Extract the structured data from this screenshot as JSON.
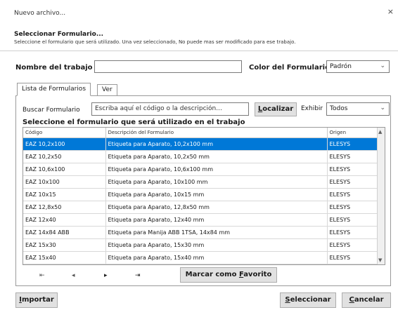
{
  "window": {
    "title": "Nuevo archivo...",
    "close": "×"
  },
  "header": {
    "section_title": "Seleccionar Formulario...",
    "description": "Seleccione el formulario que será utilizado. Una vez seleccionado, No puede mas ser modificado para ese trabajo."
  },
  "job": {
    "label": "Nombre del trabajo",
    "value": ""
  },
  "form_color": {
    "label": "Color del Formulario",
    "selected": "Padrón"
  },
  "tabs": [
    {
      "label": "Lista de Formularios",
      "active": true
    },
    {
      "label": "Ver",
      "active": false
    }
  ],
  "search": {
    "label": "Buscar Formulario",
    "placeholder": "Escriba aquí el código o la descripción...",
    "button_first": "L",
    "button_rest": "ocalizar"
  },
  "show": {
    "label": "Exhibir",
    "selected": "Todos"
  },
  "grid": {
    "title": "Seleccione el formulario que será utilizado en el trabajo",
    "columns": [
      "Código",
      "Descripción del Formulario",
      "Origen"
    ],
    "rows": [
      [
        "EAZ 10,2x100",
        "Etiqueta para Aparato, 10,2x100 mm",
        "ELESYS"
      ],
      [
        "EAZ 10,2x50",
        "Etiqueta para Aparato, 10,2x50 mm",
        "ELESYS"
      ],
      [
        "EAZ 10,6x100",
        "Etiqueta para Aparato, 10,6x100 mm",
        "ELESYS"
      ],
      [
        "EAZ 10x100",
        "Etiqueta para Aparato, 10x100 mm",
        "ELESYS"
      ],
      [
        "EAZ 10x15",
        "Etiqueta para Aparato, 10x15 mm",
        "ELESYS"
      ],
      [
        "EAZ 12,8x50",
        "Etiqueta para Aparato, 12,8x50 mm",
        "ELESYS"
      ],
      [
        "EAZ 12x40",
        "Etiqueta para Aparato, 12x40 mm",
        "ELESYS"
      ],
      [
        "EAZ 14x84 ABB",
        "Etiqueta para Manija ABB 1TSA, 14x84 mm",
        "ELESYS"
      ],
      [
        "EAZ 15x30",
        "Etiqueta para Aparato, 15x30 mm",
        "ELESYS"
      ],
      [
        "EAZ 15x40",
        "Etiqueta para Aparato, 15x40 mm",
        "ELESYS"
      ]
    ],
    "selected_row": 0
  },
  "navigation": {
    "first": "⇤",
    "prev": "◂",
    "next": "▸",
    "last": "⇥",
    "favorite_first": "Marcar como ",
    "favorite_ul": "F",
    "favorite_rest": "avorito"
  },
  "footer": {
    "import_ul": "I",
    "import_rest": "mportar",
    "select_ul": "S",
    "select_rest": "eleccionar",
    "cancel_ul": "C",
    "cancel_rest": "ancelar"
  },
  "colors": {
    "selection": "#0078d7",
    "button_bg": "#e1e1e1"
  },
  "icons": {
    "close": "close-icon",
    "dropdown": "chevron-down-icon",
    "scroll_up": "scroll-up-icon",
    "scroll_down": "scroll-down-icon"
  }
}
